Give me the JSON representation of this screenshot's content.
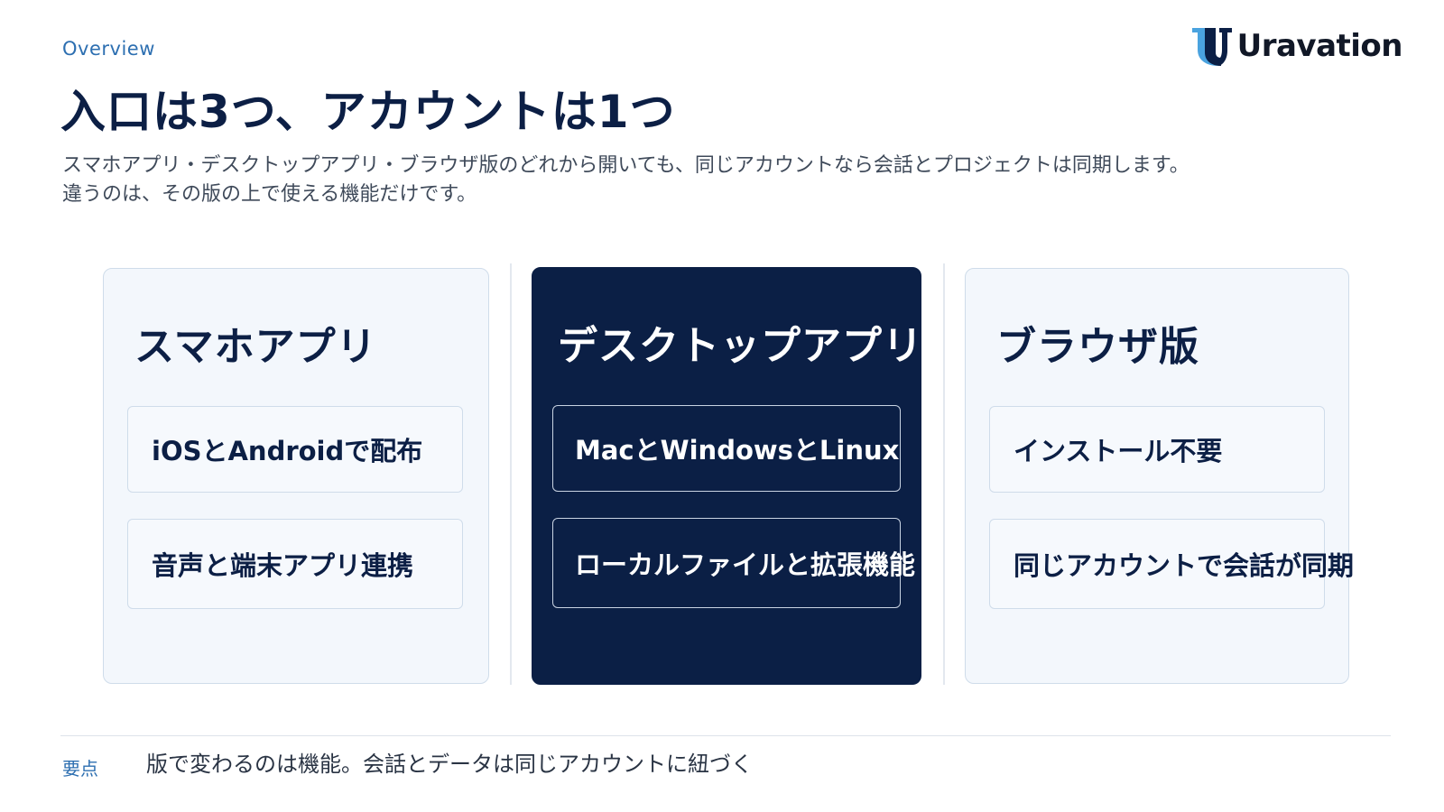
{
  "header": {
    "eyebrow": "Overview",
    "title": "入口は3つ、アカウントは1つ",
    "lead_line1": "スマホアプリ・デスクトップアプリ・ブラウザ版のどれから開いても、同じアカウントなら会話とプロジェクトは同期します。",
    "lead_line2": "違うのは、その版の上で使える機能だけです。"
  },
  "logo": {
    "text": "Uravation",
    "icon": "uravation-logo-mark"
  },
  "cards": [
    {
      "title": "スマホアプリ",
      "features": [
        "iOSとAndroidで配布",
        "音声と端末アプリ連携"
      ],
      "theme": "light"
    },
    {
      "title": "デスクトップアプリ",
      "features": [
        "MacとWindowsとLinux",
        "ローカルファイルと拡張機能"
      ],
      "theme": "dark"
    },
    {
      "title": "ブラウザ版",
      "features": [
        "インストール不要",
        "同じアカウントで会話が同期"
      ],
      "theme": "light"
    }
  ],
  "summary": {
    "label": "要点",
    "text": "版で変わるのは機能。会話とデータは同じアカウントに紐づく"
  },
  "colors": {
    "navy": "#0b1f45",
    "accent_blue": "#2d6fb1",
    "card_light": "#f3f7fc",
    "card_border": "#cfdcea"
  }
}
